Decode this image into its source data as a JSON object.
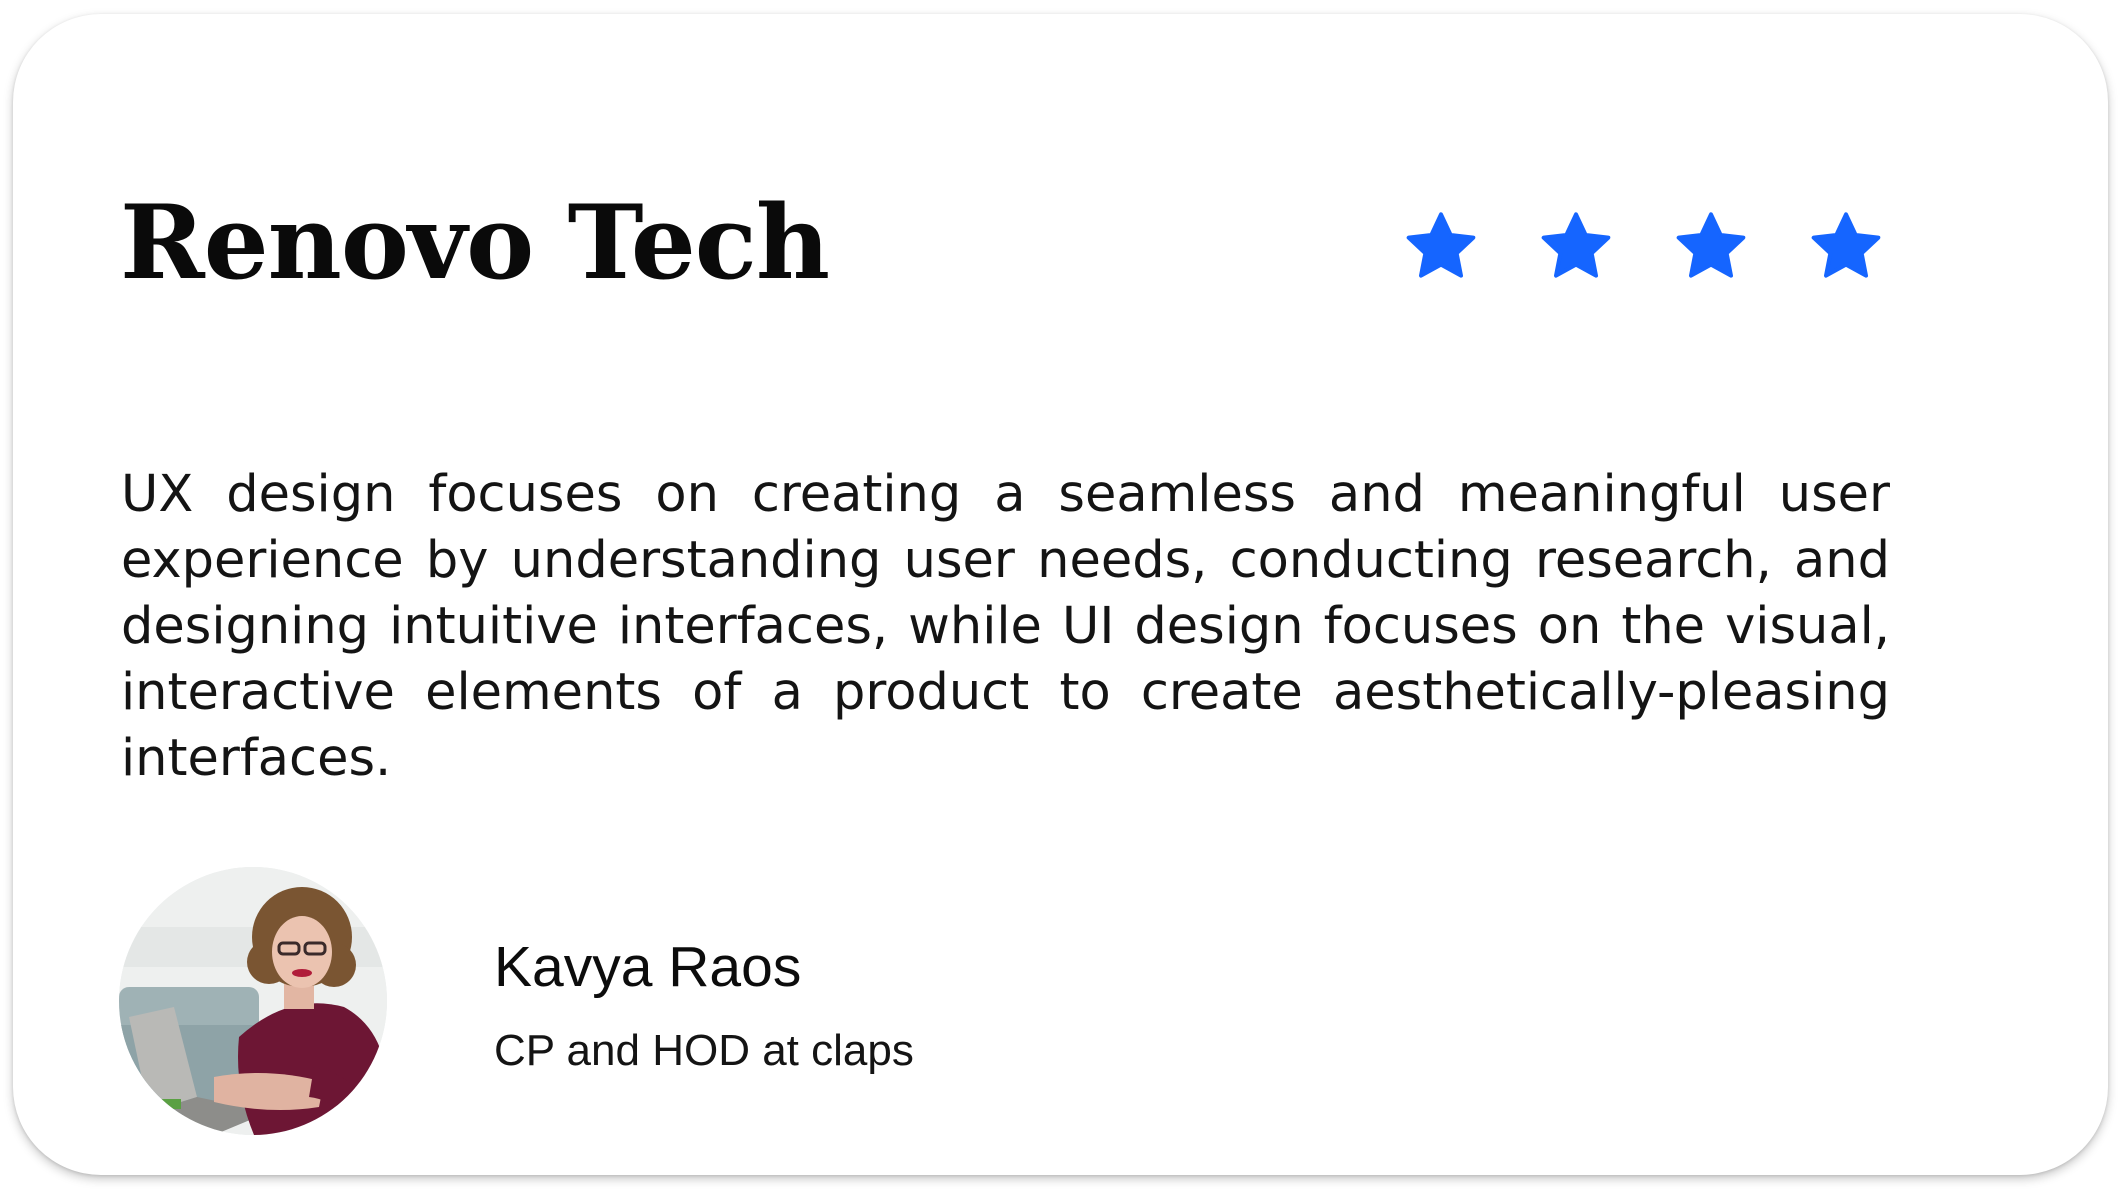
{
  "testimonial": {
    "company": "Renovo Tech",
    "rating": {
      "value": 4,
      "icon": "star-icon",
      "color": "#1565ff"
    },
    "quote": "UX design focuses on creating a seamless and meaningful user experience by understanding user needs, conducting research, and designing intuitive interfaces, while UI design focuses on the visual, interactive elements of a product to create aesthetically-pleasing interfaces.",
    "author": {
      "name": "Kavya Raos",
      "title": "CP and HOD at claps"
    }
  }
}
